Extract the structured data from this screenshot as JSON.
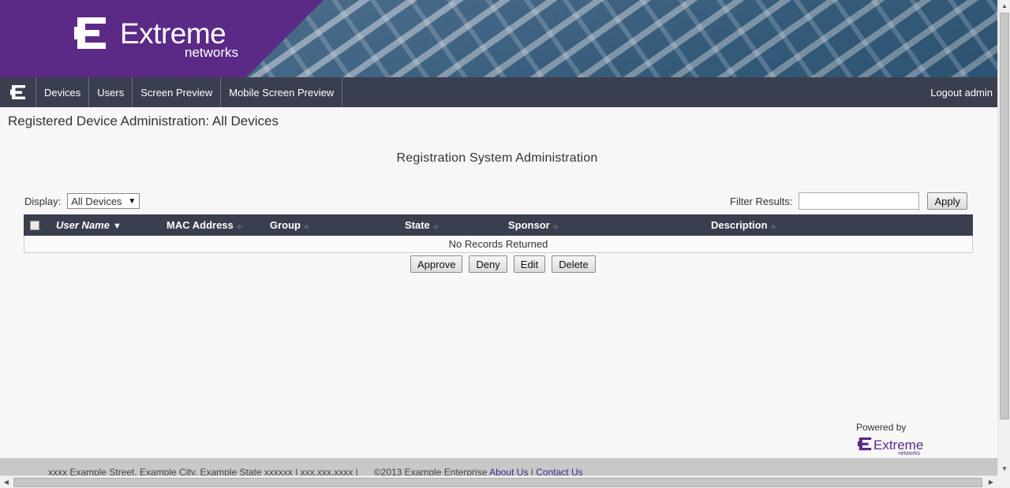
{
  "header": {
    "brand_name": "Extreme",
    "brand_sub": "networks"
  },
  "nav": {
    "items": [
      {
        "label": "Devices"
      },
      {
        "label": "Users"
      },
      {
        "label": "Screen Preview"
      },
      {
        "label": "Mobile Screen Preview"
      }
    ],
    "logout_label": "Logout admin"
  },
  "page": {
    "title": "Registered Device Administration: All Devices",
    "section_title": "Registration System Administration"
  },
  "controls": {
    "display_label": "Display:",
    "display_value": "All Devices",
    "filter_label": "Filter Results:",
    "filter_value": "",
    "apply_label": "Apply"
  },
  "table": {
    "columns": [
      "User Name",
      "MAC Address",
      "Group",
      "State",
      "Sponsor",
      "Description"
    ],
    "sorted_column": "User Name",
    "empty_message": "No Records Returned"
  },
  "actions": {
    "approve": "Approve",
    "deny": "Deny",
    "edit": "Edit",
    "delete": "Delete"
  },
  "powered_by": {
    "label": "Powered by",
    "brand": "Extreme",
    "sub": "networks"
  },
  "footer": {
    "address": "xxxx Example Street, Example City, Example State xxxxxx | xxx.xxx.xxxx |",
    "copyright": "©2013 Example Enterprise",
    "about_link": "About Us",
    "separator": "|",
    "contact_link": "Contact Us"
  },
  "colors": {
    "brand_purple": "#5b2a86",
    "nav_bg": "#3a3f4f"
  }
}
